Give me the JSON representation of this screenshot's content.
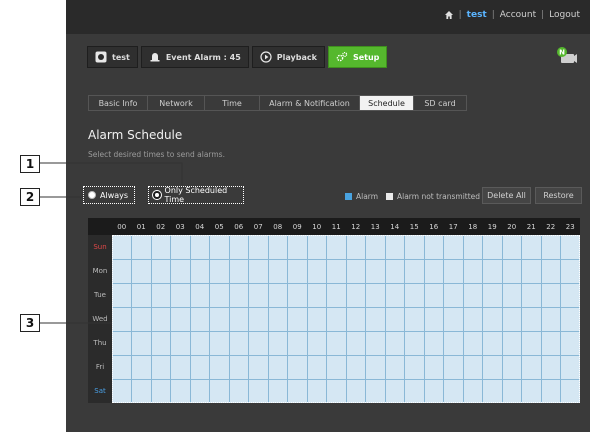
{
  "topbar": {
    "user": "test",
    "account": "Account",
    "logout": "Logout",
    "sep": "|"
  },
  "nav": [
    {
      "label": "test",
      "icon": "camera-icon"
    },
    {
      "label": "Event Alarm : 45",
      "icon": "alarm-bell-icon"
    },
    {
      "label": "Playback",
      "icon": "play-icon"
    },
    {
      "label": "Setup",
      "icon": "gears-icon",
      "active": true
    }
  ],
  "tabs": [
    {
      "label": "Basic Info"
    },
    {
      "label": "Network"
    },
    {
      "label": "Time"
    },
    {
      "label": "Alarm & Notification"
    },
    {
      "label": "Schedule",
      "active": true
    },
    {
      "label": "SD card"
    }
  ],
  "page": {
    "title": "Alarm Schedule",
    "subtitle": "Select desired times to send alarms."
  },
  "options": {
    "always": "Always",
    "scheduled": "Only Scheduled Time",
    "selected": "Only Scheduled Time"
  },
  "legend": {
    "alarm": "Alarm",
    "not_transmitted": "Alarm not transmitted"
  },
  "buttons": {
    "delete_all": "Delete All",
    "restore": "Restore"
  },
  "hours": [
    "00",
    "01",
    "02",
    "03",
    "04",
    "05",
    "06",
    "07",
    "08",
    "09",
    "10",
    "11",
    "12",
    "13",
    "14",
    "15",
    "16",
    "17",
    "18",
    "19",
    "20",
    "21",
    "22",
    "23"
  ],
  "days": [
    "Sun",
    "Mon",
    "Tue",
    "Wed",
    "Thu",
    "Fri",
    "Sat"
  ],
  "callouts": [
    "1",
    "2",
    "3"
  ],
  "colors": {
    "setup_active": "#55b82d",
    "alarm": "#49a3e0",
    "not_transmitted": "#e9e9e9",
    "sun": "#e04848",
    "sat": "#4aa0e6",
    "weekday": "#bbbbbb",
    "user_link": "#5ab4ff"
  }
}
